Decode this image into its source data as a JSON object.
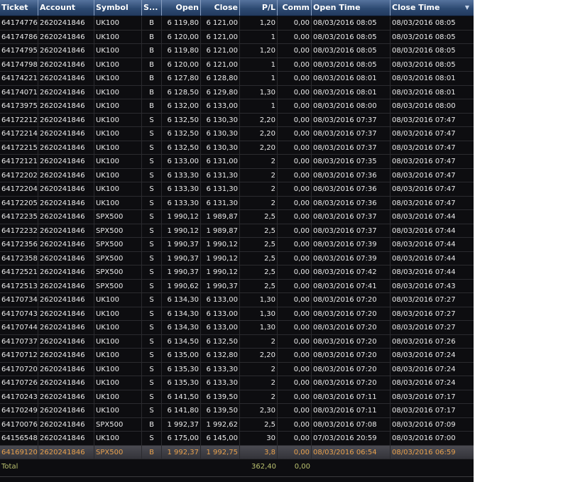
{
  "columns": [
    "Ticket",
    "Account",
    "Symbol",
    "S...",
    "Open",
    "Close",
    "P/L",
    "Comm",
    "Open Time",
    "Close Time"
  ],
  "rows": [
    [
      "64174776",
      "2620241846",
      "UK100",
      "B",
      "6 119,80",
      "6 121,00",
      "1,20",
      "0,00",
      "08/03/2016 08:05",
      "08/03/2016 08:05"
    ],
    [
      "64174786",
      "2620241846",
      "UK100",
      "B",
      "6 120,00",
      "6 121,00",
      "1",
      "0,00",
      "08/03/2016 08:05",
      "08/03/2016 08:05"
    ],
    [
      "64174795",
      "2620241846",
      "UK100",
      "B",
      "6 119,80",
      "6 121,00",
      "1,20",
      "0,00",
      "08/03/2016 08:05",
      "08/03/2016 08:05"
    ],
    [
      "64174798",
      "2620241846",
      "UK100",
      "B",
      "6 120,00",
      "6 121,00",
      "1",
      "0,00",
      "08/03/2016 08:05",
      "08/03/2016 08:05"
    ],
    [
      "64174221",
      "2620241846",
      "UK100",
      "B",
      "6 127,80",
      "6 128,80",
      "1",
      "0,00",
      "08/03/2016 08:01",
      "08/03/2016 08:01"
    ],
    [
      "64174071",
      "2620241846",
      "UK100",
      "B",
      "6 128,50",
      "6 129,80",
      "1,30",
      "0,00",
      "08/03/2016 08:01",
      "08/03/2016 08:01"
    ],
    [
      "64173975",
      "2620241846",
      "UK100",
      "B",
      "6 132,00",
      "6 133,00",
      "1",
      "0,00",
      "08/03/2016 08:00",
      "08/03/2016 08:00"
    ],
    [
      "64172212",
      "2620241846",
      "UK100",
      "S",
      "6 132,50",
      "6 130,30",
      "2,20",
      "0,00",
      "08/03/2016 07:37",
      "08/03/2016 07:47"
    ],
    [
      "64172214",
      "2620241846",
      "UK100",
      "S",
      "6 132,50",
      "6 130,30",
      "2,20",
      "0,00",
      "08/03/2016 07:37",
      "08/03/2016 07:47"
    ],
    [
      "64172215",
      "2620241846",
      "UK100",
      "S",
      "6 132,50",
      "6 130,30",
      "2,20",
      "0,00",
      "08/03/2016 07:37",
      "08/03/2016 07:47"
    ],
    [
      "64172121",
      "2620241846",
      "UK100",
      "S",
      "6 133,00",
      "6 131,00",
      "2",
      "0,00",
      "08/03/2016 07:35",
      "08/03/2016 07:47"
    ],
    [
      "64172202",
      "2620241846",
      "UK100",
      "S",
      "6 133,30",
      "6 131,30",
      "2",
      "0,00",
      "08/03/2016 07:36",
      "08/03/2016 07:47"
    ],
    [
      "64172204",
      "2620241846",
      "UK100",
      "S",
      "6 133,30",
      "6 131,30",
      "2",
      "0,00",
      "08/03/2016 07:36",
      "08/03/2016 07:47"
    ],
    [
      "64172205",
      "2620241846",
      "UK100",
      "S",
      "6 133,30",
      "6 131,30",
      "2",
      "0,00",
      "08/03/2016 07:36",
      "08/03/2016 07:47"
    ],
    [
      "64172235",
      "2620241846",
      "SPX500",
      "S",
      "1 990,12",
      "1 989,87",
      "2,5",
      "0,00",
      "08/03/2016 07:37",
      "08/03/2016 07:44"
    ],
    [
      "64172232",
      "2620241846",
      "SPX500",
      "S",
      "1 990,12",
      "1 989,87",
      "2,5",
      "0,00",
      "08/03/2016 07:37",
      "08/03/2016 07:44"
    ],
    [
      "64172356",
      "2620241846",
      "SPX500",
      "S",
      "1 990,37",
      "1 990,12",
      "2,5",
      "0,00",
      "08/03/2016 07:39",
      "08/03/2016 07:44"
    ],
    [
      "64172358",
      "2620241846",
      "SPX500",
      "S",
      "1 990,37",
      "1 990,12",
      "2,5",
      "0,00",
      "08/03/2016 07:39",
      "08/03/2016 07:44"
    ],
    [
      "64172521",
      "2620241846",
      "SPX500",
      "S",
      "1 990,37",
      "1 990,12",
      "2,5",
      "0,00",
      "08/03/2016 07:42",
      "08/03/2016 07:44"
    ],
    [
      "64172513",
      "2620241846",
      "SPX500",
      "S",
      "1 990,62",
      "1 990,37",
      "2,5",
      "0,00",
      "08/03/2016 07:41",
      "08/03/2016 07:43"
    ],
    [
      "64170734",
      "2620241846",
      "UK100",
      "S",
      "6 134,30",
      "6 133,00",
      "1,30",
      "0,00",
      "08/03/2016 07:20",
      "08/03/2016 07:27"
    ],
    [
      "64170743",
      "2620241846",
      "UK100",
      "S",
      "6 134,30",
      "6 133,00",
      "1,30",
      "0,00",
      "08/03/2016 07:20",
      "08/03/2016 07:27"
    ],
    [
      "64170744",
      "2620241846",
      "UK100",
      "S",
      "6 134,30",
      "6 133,00",
      "1,30",
      "0,00",
      "08/03/2016 07:20",
      "08/03/2016 07:27"
    ],
    [
      "64170737",
      "2620241846",
      "UK100",
      "S",
      "6 134,50",
      "6 132,50",
      "2",
      "0,00",
      "08/03/2016 07:20",
      "08/03/2016 07:26"
    ],
    [
      "64170712",
      "2620241846",
      "UK100",
      "S",
      "6 135,00",
      "6 132,80",
      "2,20",
      "0,00",
      "08/03/2016 07:20",
      "08/03/2016 07:24"
    ],
    [
      "64170720",
      "2620241846",
      "UK100",
      "S",
      "6 135,30",
      "6 133,30",
      "2",
      "0,00",
      "08/03/2016 07:20",
      "08/03/2016 07:24"
    ],
    [
      "64170726",
      "2620241846",
      "UK100",
      "S",
      "6 135,30",
      "6 133,30",
      "2",
      "0,00",
      "08/03/2016 07:20",
      "08/03/2016 07:24"
    ],
    [
      "64170243",
      "2620241846",
      "UK100",
      "S",
      "6 141,50",
      "6 139,50",
      "2",
      "0,00",
      "08/03/2016 07:11",
      "08/03/2016 07:17"
    ],
    [
      "64170249",
      "2620241846",
      "UK100",
      "S",
      "6 141,80",
      "6 139,50",
      "2,30",
      "0,00",
      "08/03/2016 07:11",
      "08/03/2016 07:17"
    ],
    [
      "64170076",
      "2620241846",
      "SPX500",
      "B",
      "1 992,37",
      "1 992,62",
      "2,5",
      "0,00",
      "08/03/2016 07:08",
      "08/03/2016 07:09"
    ],
    [
      "64156548",
      "2620241846",
      "UK100",
      "S",
      "6 175,00",
      "6 145,00",
      "30",
      "0,00",
      "07/03/2016 20:59",
      "08/03/2016 07:00"
    ],
    [
      "64169120",
      "2620241846",
      "SPX500",
      "B",
      "1 992,37",
      "1 992,75",
      "3,8",
      "0,00",
      "08/03/2016 06:54",
      "08/03/2016 06:59"
    ]
  ],
  "selected_row": 31,
  "total": {
    "label": "Total",
    "pl": "362,40",
    "comm": "0,00"
  },
  "colors": {
    "header_bg": "#2d4a72",
    "row_bg": "#0d0d10",
    "selected_text": "#e7a04d",
    "total_text": "#b9c06e"
  }
}
